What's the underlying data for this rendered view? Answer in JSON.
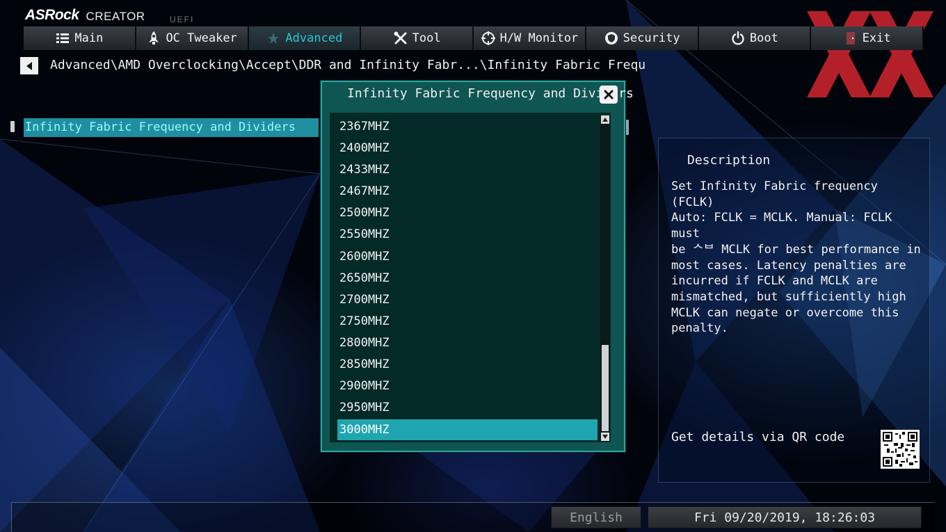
{
  "brand": {
    "name": "ASRock",
    "product": "CREATOR",
    "firmware": "UEFI"
  },
  "tabs": [
    {
      "label": "Main",
      "icon": "list-icon",
      "active": false
    },
    {
      "label": "OC Tweaker",
      "icon": "rocket-icon",
      "active": false
    },
    {
      "label": "Advanced",
      "icon": "star-icon",
      "active": true
    },
    {
      "label": "Tool",
      "icon": "tools-icon",
      "active": false
    },
    {
      "label": "H/W Monitor",
      "icon": "crosshair-icon",
      "active": false
    },
    {
      "label": "Security",
      "icon": "shield-icon",
      "active": false
    },
    {
      "label": "Boot",
      "icon": "power-icon",
      "active": false
    },
    {
      "label": "Exit",
      "icon": "exit-door-icon",
      "active": false
    }
  ],
  "breadcrumb": "Advanced\\AMD Overclocking\\Accept\\DDR and Infinity Fabr...\\Infinity Fabric Frequ",
  "left_panel": {
    "selected_item": "Infinity Fabric Frequency and Dividers"
  },
  "popup": {
    "title": "Infinity Fabric Frequency and Dividers",
    "options": [
      "2367MHZ",
      "2400MHZ",
      "2433MHZ",
      "2467MHZ",
      "2500MHZ",
      "2550MHZ",
      "2600MHZ",
      "2650MHZ",
      "2700MHZ",
      "2750MHZ",
      "2800MHZ",
      "2850MHZ",
      "2900MHZ",
      "2950MHZ",
      "3000MHZ"
    ],
    "selected": "3000MHZ"
  },
  "description": {
    "title": "Description",
    "text": "Set Infinity Fabric frequency (FCLK)\nAuto: FCLK = MCLK. Manual: FCLK must\nbe ᄉᄇ MCLK for best performance in\nmost cases. Latency penalties are\nincurred if FCLK and MCLK are\nmismatched, but sufficiently high\nMCLK can negate or overcome this\npenalty.",
    "qr_label": "Get details via QR code"
  },
  "footer": {
    "language": "English",
    "datetime": "Fri 09/20/2019, 18:26:03"
  },
  "colors": {
    "accent": "#27c5d3",
    "popup_bg": "#0f5552",
    "selected_bg": "#1fa5b0",
    "watermark": "#d4262f"
  }
}
